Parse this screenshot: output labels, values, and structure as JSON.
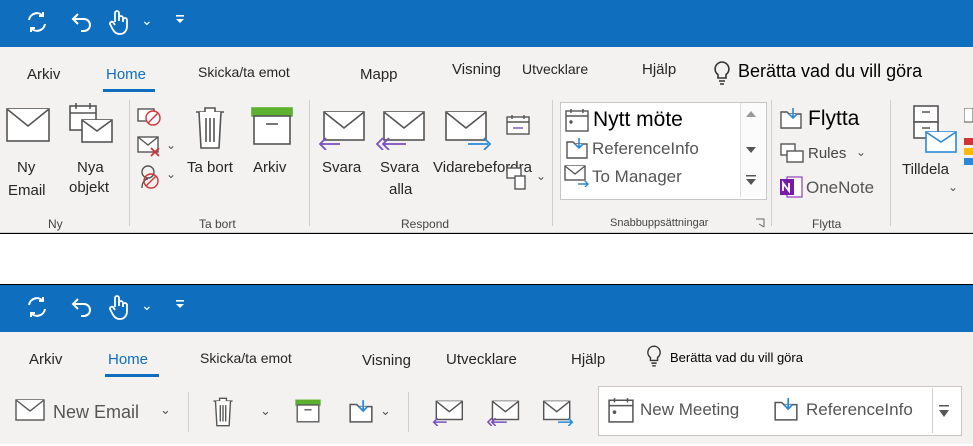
{
  "top": {
    "tabs": {
      "arkiv": "Arkiv",
      "home": "Home",
      "skicka": "Skicka/ta emot",
      "mapp": "Mapp",
      "visning": "Visning",
      "utvecklare": "Utvecklare",
      "hjalp": "Hjälp"
    },
    "tell_me": "Berätta vad du vill göra",
    "ny_email": [
      "Ny",
      "Email"
    ],
    "nya_objekt": [
      "Nya",
      "objekt"
    ],
    "ta_bort": "Ta bort",
    "arkiv_btn": "Arkiv",
    "svara": "Svara",
    "svara_alla": [
      "Svara",
      "alla"
    ],
    "vidarebefordra": "Vidarebefordra",
    "quick_steps": {
      "nytt_mote": "Nytt möte",
      "reference_info": "ReferenceInfo",
      "to_manager": "To Manager"
    },
    "flytta_btn": "Flytta",
    "rules": "Rules",
    "onenote": "OneNote",
    "tilldela": "Tilldela",
    "groups": {
      "ny": "Ny",
      "ta_bort": "Ta bort",
      "respond": "Respond",
      "snabb": "Snabbuppsättningar",
      "flytta": "Flytta"
    }
  },
  "bottom": {
    "tabs": {
      "arkiv": "Arkiv",
      "home": "Home",
      "skicka": "Skicka/ta emot",
      "visning": "Visning",
      "utvecklare": "Utvecklare",
      "hjalp": "Hjälp"
    },
    "tell_me": "Berätta vad du vill göra",
    "new_email": "New Email",
    "new_meeting": "New Meeting",
    "reference_info": "ReferenceInfo"
  },
  "colors": {
    "accent": "#106ebe",
    "reply_purple": "#7a4fbf",
    "delete_red": "#d13438",
    "archive_green": "#5db12f",
    "onenote_purple": "#7719aa",
    "move_blue": "#2b88d8"
  },
  "glyphs": {
    "dropdown": "⌄",
    "overflow": "⌄"
  }
}
